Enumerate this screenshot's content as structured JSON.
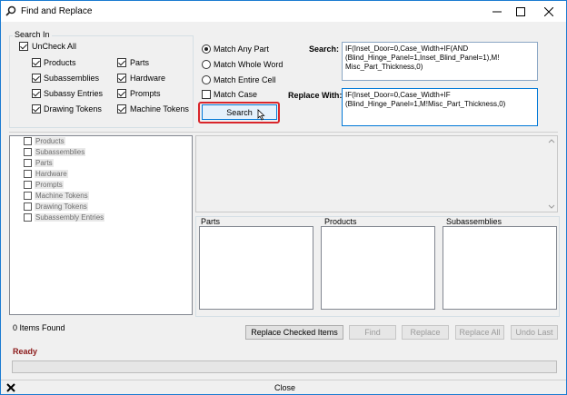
{
  "window": {
    "title": "Find and Replace",
    "icon": "search-icon",
    "controls": {
      "minimize": "minimize-icon",
      "maximize": "maximize-icon",
      "close": "close-icon"
    }
  },
  "search_in": {
    "group_label": "Search In",
    "uncheck_all": {
      "label": "UnCheck All",
      "checked": true
    },
    "items": [
      {
        "label": "Products",
        "checked": true
      },
      {
        "label": "Subassemblies",
        "checked": true
      },
      {
        "label": "Subassy Entries",
        "checked": true
      },
      {
        "label": "Drawing Tokens",
        "checked": true
      },
      {
        "label": "Parts",
        "checked": true
      },
      {
        "label": "Hardware",
        "checked": true
      },
      {
        "label": "Prompts",
        "checked": true
      },
      {
        "label": "Machine Tokens",
        "checked": true
      }
    ]
  },
  "match_options": {
    "match_any_part": "Match Any Part",
    "match_whole_word": "Match Whole Word",
    "match_entire_cell": "Match Entire Cell",
    "match_case": "Match Case",
    "search_button": "Search"
  },
  "search": {
    "label": "Search:",
    "value": "IF(Inset_Door=0,Case_Width+IF(AND\n(Blind_Hinge_Panel=1,Inset_Blind_Panel=1),M!\nMisc_Part_Thickness,0)"
  },
  "replace": {
    "label": "Replace With:",
    "value": "IF(Inset_Door=0,Case_Width+IF\n(Blind_Hinge_Panel=1,M!Misc_Part_Thickness,0)"
  },
  "tree": {
    "items": [
      "Products",
      "Subassemblies",
      "Parts",
      "Hardware",
      "Prompts",
      "Machine Tokens",
      "Drawing Tokens",
      "Subassembly Entries"
    ]
  },
  "results": {
    "parts_label": "Parts",
    "products_label": "Products",
    "subassemblies_label": "Subassemblies"
  },
  "footer": {
    "items_found": "0 Items Found",
    "replace_checked": "Replace Checked Items",
    "find": "Find",
    "replace": "Replace",
    "replace_all": "Replace All",
    "undo_last": "Undo Last",
    "status": "Ready",
    "close_label": "Close",
    "status_color": "#8b1a1a",
    "highlight_color": "#d9262b"
  }
}
